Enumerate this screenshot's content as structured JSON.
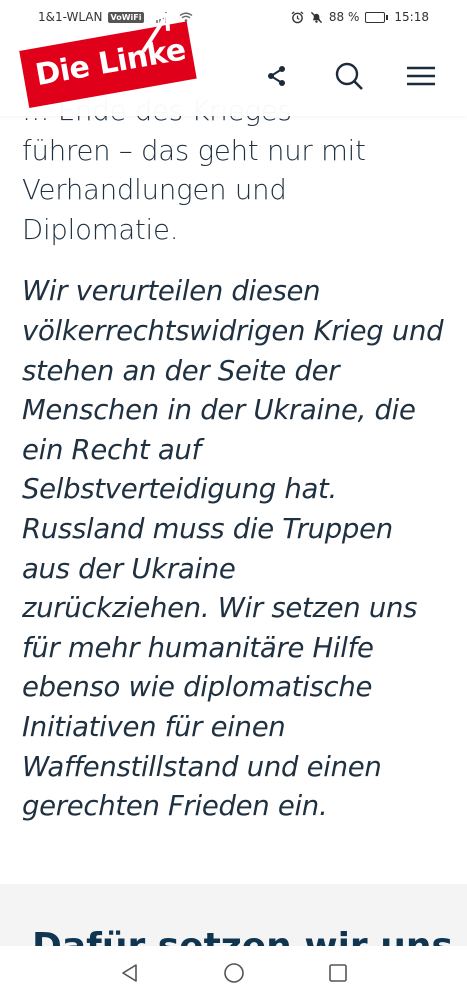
{
  "status_bar": {
    "carrier": "1&1-WLAN",
    "vowifi": "VoWiFi",
    "battery_percent": "88 %",
    "battery_level": 0.88,
    "time": "15:18"
  },
  "header": {
    "logo_text": "Die Linke",
    "brand_color": "#e1001a",
    "icons": [
      "share-icon",
      "search-icon",
      "menu-icon"
    ]
  },
  "article": {
    "paragraph1_lines": [
      "… Ende des Krieges",
      "führen – das geht nur mit",
      "Verhandlungen und",
      "Diplomatie."
    ],
    "paragraph2_lines": [
      "Wir verurteilen diesen",
      "völkerrechtswidrigen Krieg und",
      "stehen an der Seite der",
      "Menschen in der Ukraine, die",
      "ein Recht auf",
      "Selbstverteidigung hat.",
      "Russland muss die Truppen",
      "aus der Ukraine",
      "zurückziehen. Wir setzen uns",
      "für mehr humanitäre Hilfe",
      "ebenso wie diplomatische",
      "Initiativen für einen",
      "Waffenstillstand und einen",
      "gerechten Frieden ein."
    ]
  },
  "section": {
    "heading": "Dafür setzen wir uns"
  },
  "nav_bar": {
    "icons": [
      "back-icon",
      "home-icon",
      "recents-icon"
    ]
  }
}
